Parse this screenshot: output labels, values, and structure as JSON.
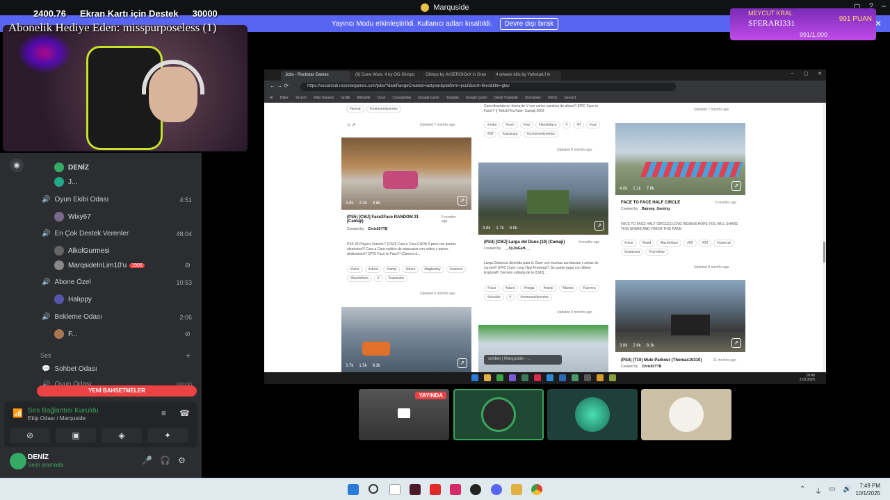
{
  "window": {
    "title": "Marquside"
  },
  "overlay": {
    "stat1": "2400.76",
    "stat2": "Ekran Kartı için Destek",
    "stat3": "30000",
    "subscription": "Abonelik Hediye Eden: misspurposeless (1)"
  },
  "king": {
    "label": "MEYCUT KRAL",
    "name": "SFERARI331",
    "points": "991 PUAN",
    "progress": "991/1,000"
  },
  "notice": {
    "text": "Yayıncı Modu etkinleştirildi. Kullanıcı adları kısaltıldı.",
    "button": "Devre dışı bırak"
  },
  "sidebar": {
    "items": [
      {
        "type": "user",
        "name": "DENİZ"
      },
      {
        "type": "user",
        "name": "J..."
      },
      {
        "type": "channel",
        "name": "Oyun Ekibi Odası",
        "time": "4:51"
      },
      {
        "type": "user",
        "name": "Wixy67"
      },
      {
        "type": "channel",
        "name": "En Çok Destek Verenler",
        "time": "48:04"
      },
      {
        "type": "user",
        "name": "AlkolGurmesi"
      },
      {
        "type": "user",
        "name": "MarqsideInLim10'u",
        "badge": "1905"
      },
      {
        "type": "channel",
        "name": "Abone Özel",
        "time": "10:53"
      },
      {
        "type": "user",
        "name": "Halıppy"
      },
      {
        "type": "channel",
        "name": "Bekleme Odası",
        "time": "2:06"
      },
      {
        "type": "user",
        "name": "F..."
      },
      {
        "type": "section",
        "name": "Ses"
      },
      {
        "type": "channel",
        "name": "Sohbet Odası"
      },
      {
        "type": "channel",
        "name": "Oyun Odası",
        "time": "00:00"
      }
    ],
    "yeni": "YENİ BAHSETMELER"
  },
  "voice": {
    "status": "Ses Bağlantısı Kuruldu",
    "channel": "Ekip Odası / Marquside"
  },
  "me": {
    "name": "DENİZ",
    "status": "Sesli aramada"
  },
  "browser": {
    "tabs": [
      "Jobs - Rockstar Games",
      "(6) Dune Wars: 4 by OG-Stimpo",
      "Olimpo by XxSERGIOxX in Gran",
      "4 wheels hills by YorkstarLf in"
    ],
    "url": "https://socialclub.rockstargames.com/jobs/?dateRangeCreated=lastyear&platform=pcult&sort=likes&title=gtav",
    "bookmarks": [
      "AI",
      "Diğer",
      "Yazılım",
      "Web Tasarım",
      "Grafik",
      "Mimarlık",
      "Oyun",
      "Crossplatter",
      "Google Çeviri",
      "Youtube",
      "Google Çeviri",
      "Deepl Translate",
      "Domainler",
      "Demo",
      "Server1"
    ]
  },
  "cards": {
    "top_col1": {
      "tags": [
        "#arena",
        "#communityseries"
      ],
      "updated": "Updated 7 months ago"
    },
    "top_col2": {
      "desc": "Cara divertida en forma de V con varios cambios de altura!!! EPIC Face to Face!!! || Twitch/YouTube: Camaji 2002",
      "tags": [
        "#volta",
        "#vom",
        "#vai",
        "#facetoface",
        "#",
        "#ff",
        "#cac",
        "#f2f",
        "#caracara",
        "#communityseries"
      ],
      "updated": "Updated 8 months ago"
    },
    "top_col3": {
      "updated": "Updated 7 months ago"
    },
    "c1": {
      "title": "(PS5) [CMJ] Face2Face RANDOM 21 (Camaji)",
      "ago": "5 months ago",
      "by": "Created by",
      "author": "Chris92YTB",
      "stats": [
        "3.9k",
        "2.3k",
        "9.6k"
      ],
      "desc": "PS5 30 Players Version !! [CMJ] Cara a Cara CAOS 5 pero con puntos aleatorios!!! Cara a Cara caótico de atascazos con saltos y partes deslizantes!!! EPIC Face to Face!!! (Carrera d...",
      "tags": [
        "#race",
        "#stunt",
        "#ramp",
        "#dune",
        "#tagteamy",
        "#carrera",
        "#facetoface",
        "#",
        "#caracara"
      ],
      "updated": "Updated 6 months ago"
    },
    "c2": {
      "title": "(PS4) [CMJ] Larga del Dune (10) (Camaji)",
      "ago": "9 months ago",
      "by": "Created by",
      "author": "__XyJluGaH-__",
      "stats": [
        "3.8k",
        "1.7k",
        "8.0k"
      ],
      "desc": "Larga Distancia divertida para in Dune con muchas acrobacias y zonas de curvas!!! EPIC Dune Long Haul Freeway!!! Se puede jugar con último Explorall!! (Versión editada de la [CMJ]...",
      "tags": [
        "#race",
        "#stunt",
        "#mega",
        "#ramp",
        "#dunes",
        "#carrera",
        "#circuito",
        "#",
        "#communityseries"
      ],
      "updated": "Updated 9 months ago"
    },
    "c3": {
      "title": "FACE TO FACE HALF CIRCLE",
      "ago": "6 months ago",
      "by": "Created by",
      "author": "Bajrang_Gaming",
      "stats": [
        "4.0k",
        "2.1k",
        "7.8k"
      ],
      "desc": "FACE TO FACE HALF CIRCLES LOVE INDIANS HOPE YOU WILL SHARE THIS SHARE AND FINISH THIS RACE",
      "tags": [
        "#race",
        "#hard",
        "#facetoface",
        "#f2f",
        "#f2f",
        "#cavecar",
        "#caracara",
        "#curvelow"
      ],
      "updated": "Updated 8 months ago"
    },
    "c4": {
      "stats": [
        "3.7k",
        "1.5k",
        "8.3k"
      ]
    },
    "c6": {
      "title": "(PS4) (T10) Mule Parkour (Thomas10310)",
      "ago": "11 months ago",
      "by": "Created by",
      "author": "Chris92YTB",
      "stats": [
        "3.8k",
        "2.6k",
        "8.1k"
      ]
    }
  },
  "disc_tip": "sohbet | Marquside - ...",
  "inner_clock": {
    "time": "18:49",
    "date": "3.03.2025"
  },
  "tiles": {
    "live": "YAYINDA"
  },
  "clock": {
    "time": "7:49 PM",
    "date": "10/1/2025"
  }
}
